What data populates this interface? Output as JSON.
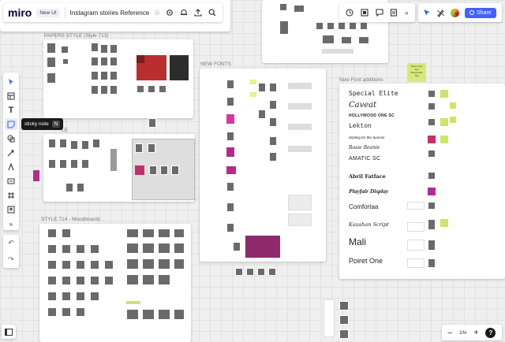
{
  "header": {
    "logo": "miro",
    "badge": "New UI",
    "board_title": "Instagram stories Reference",
    "icons": [
      "star-icon",
      "settings-icon",
      "bell-icon",
      "upload-icon",
      "search-icon"
    ]
  },
  "top_right": {
    "icons": [
      "timer-icon",
      "frames-icon",
      "comment-icon",
      "notes-icon",
      "more-icon",
      "cursor-icon",
      "pen-icon"
    ],
    "share_label": "Share"
  },
  "toolbar": {
    "tooltip": "sticky note",
    "tooltip_key": "N"
  },
  "frames": {
    "papers": "PAPERS STYLE (Style 713)",
    "mid": "LE",
    "new_fonts": "NEW FONTS",
    "moodboards": "STYLE 714 - Moodboards",
    "font_additions": "New Font additions"
  },
  "font_additions": [
    "Special Elite",
    "Caveat",
    "HOLLYWOOD ONE SC",
    "Lekton",
    "Waiting for the Sunrise",
    "Rosie Beanie",
    "AMATIC SC",
    "Abril Fatface",
    "Playfair Display",
    "Comfortaa",
    "Kaushan Script",
    "Mali",
    "Poiret One"
  ],
  "sticky_note_text": "Sticky Note Text Placeholder Tag",
  "zoom": {
    "value": "1%",
    "minus": "–",
    "plus": "+",
    "help": "?"
  }
}
